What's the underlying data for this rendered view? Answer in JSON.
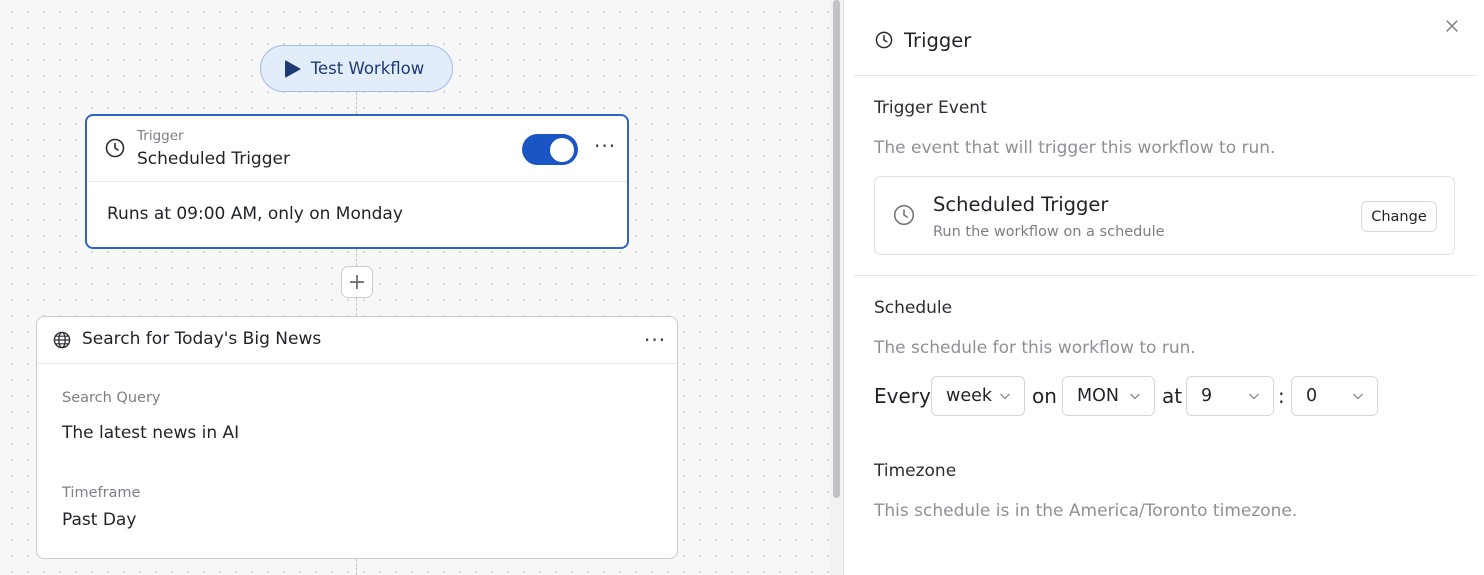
{
  "canvas": {
    "test_button_label": "Test Workflow",
    "trigger_node": {
      "type_label": "Trigger",
      "title": "Scheduled Trigger",
      "enabled": true,
      "summary": "Runs at 09:00 AM, only on Monday"
    },
    "search_node": {
      "title": "Search for Today's Big News",
      "fields": [
        {
          "label": "Search Query",
          "value": "The latest news in AI"
        },
        {
          "label": "Timeframe",
          "value": "Past Day"
        }
      ]
    }
  },
  "panel": {
    "title": "Trigger",
    "trigger_event": {
      "heading": "Trigger Event",
      "description": "The event that will trigger this workflow to run.",
      "selected": {
        "title": "Scheduled Trigger",
        "subtitle": "Run the workflow on a schedule",
        "change_label": "Change"
      }
    },
    "schedule": {
      "heading": "Schedule",
      "description": "The schedule for this workflow to run.",
      "every_label": "Every",
      "on_label": "on",
      "at_label": "at",
      "colon": ":",
      "frequency": "week",
      "day": "MON",
      "hour": "9",
      "minute": "0"
    },
    "timezone": {
      "heading": "Timezone",
      "description": "This schedule is in the America/Toronto timezone."
    }
  },
  "colors": {
    "accent": "#1a55c4",
    "selected_border": "#2f63c7",
    "test_button_bg": "#e3ecf9"
  }
}
